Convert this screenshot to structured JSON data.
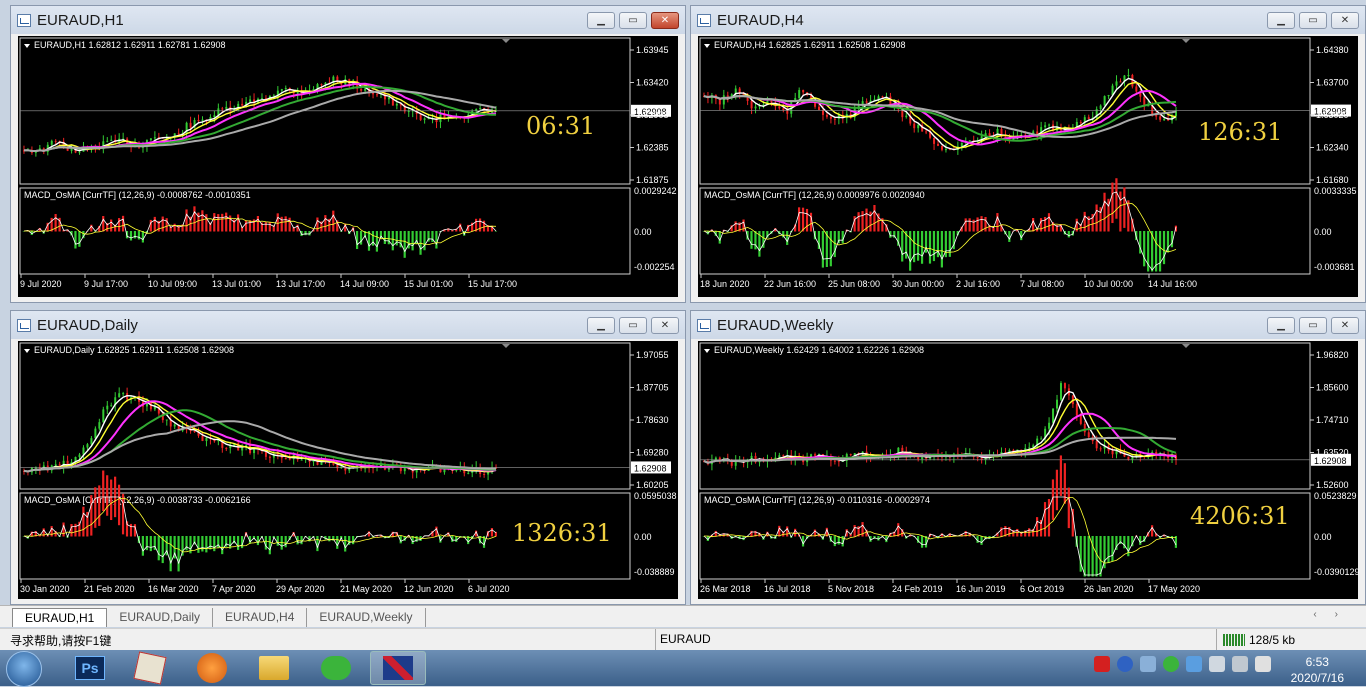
{
  "windows": [
    {
      "id": "h1",
      "title": "EURAUD,H1",
      "info": "EURAUD,H1  1.62812 1.62911 1.62781 1.62908",
      "macd": "MACD_OsMA [CurrTF] (12,26,9) -0.0008762 -0.0010351",
      "prices": [
        "1.63945",
        "1.63420",
        "1.62908",
        "1.62385",
        "1.61875"
      ],
      "macd_scale": [
        "0.0029242",
        "0.00",
        "-0.002254"
      ],
      "dates": [
        "9 Jul 2020",
        "9 Jul 17:00",
        "10 Jul 09:00",
        "13 Jul 01:00",
        "13 Jul 17:00",
        "14 Jul 09:00",
        "15 Jul 01:00",
        "15 Jul 17:00"
      ],
      "countdown": "06:31",
      "current": "1.62908"
    },
    {
      "id": "h4",
      "title": "EURAUD,H4",
      "info": "EURAUD,H4  1.62825 1.62911 1.62508 1.62908",
      "macd": "MACD_OsMA [CurrTF] (12,26,9) 0.0009976 0.0020940",
      "prices": [
        "1.64380",
        "1.63700",
        "1.63020",
        "1.62340",
        "1.61680"
      ],
      "macd_scale": [
        "0.0033335",
        "0.00",
        "-0.003681"
      ],
      "dates": [
        "18 Jun 2020",
        "22 Jun 16:00",
        "25 Jun 08:00",
        "30 Jun 00:00",
        "2 Jul 16:00",
        "7 Jul 08:00",
        "10 Jul 00:00",
        "14 Jul 16:00"
      ],
      "countdown": "126:31",
      "current": "1.62908"
    },
    {
      "id": "d1",
      "title": "EURAUD,Daily",
      "info": "EURAUD,Daily  1.62825 1.62911 1.62508 1.62908",
      "macd": "MACD_OsMA [CurrTF] (12,26,9) -0.0038733 -0.0062166",
      "prices": [
        "1.97055",
        "1.87705",
        "1.78630",
        "1.69280",
        "1.60205"
      ],
      "macd_scale": [
        "0.0595038",
        "0.00",
        "-0.038889"
      ],
      "dates": [
        "30 Jan 2020",
        "21 Feb 2020",
        "16 Mar 2020",
        "7 Apr 2020",
        "29 Apr 2020",
        "21 May 2020",
        "12 Jun 2020",
        "6 Jul 2020"
      ],
      "countdown": "1326:31",
      "current": "1.62908"
    },
    {
      "id": "w1",
      "title": "EURAUD,Weekly",
      "info": "EURAUD,Weekly  1.62429 1.64002 1.62226 1.62908",
      "macd": "MACD_OsMA [CurrTF] (12,26,9) -0.0110316 -0.0002974",
      "prices": [
        "1.96820",
        "1.85600",
        "1.74710",
        "1.63520",
        "1.52600"
      ],
      "macd_scale": [
        "0.0523829",
        "0.00",
        "-0.0390129"
      ],
      "dates": [
        "26 Mar 2018",
        "16 Jul 2018",
        "5 Nov 2018",
        "24 Feb 2019",
        "16 Jun 2019",
        "6 Oct 2019",
        "26 Jan 2020",
        "17 May 2020"
      ],
      "countdown": "4206:31",
      "current": "1.62908"
    }
  ],
  "tabs": [
    "EURAUD,H1",
    "EURAUD,Daily",
    "EURAUD,H4",
    "EURAUD,Weekly"
  ],
  "status": {
    "help": "寻求帮助,请按F1键",
    "symbol": "EURAUD",
    "traffic": "128/5 kb"
  },
  "taskbar": {
    "ps": "Ps",
    "time": "6:53",
    "date": "2020/7/16"
  },
  "colors": {
    "bull": "#33cc33",
    "bear": "#ee2222",
    "ma_white": "#ffffff",
    "ma_yellow": "#ffff33",
    "ma_magenta": "#ff33ff",
    "ma_green": "#33aa33",
    "ma_gray": "#aaaaaa"
  }
}
